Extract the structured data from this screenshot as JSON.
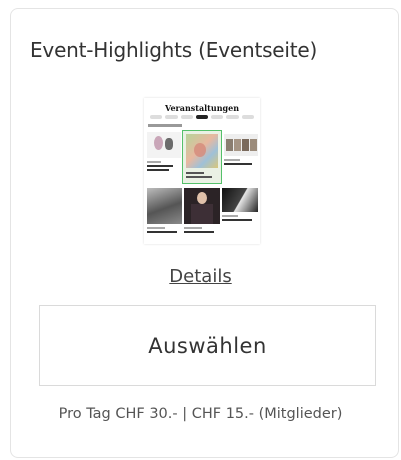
{
  "card": {
    "title": "Event-Highlights (Eventseite)",
    "preview": {
      "masthead": "Veranstaltungen"
    },
    "details_link": "Details",
    "select_button": "Auswählen",
    "price_text": "Pro Tag CHF 30.- | CHF 15.- (Mitglieder)"
  }
}
